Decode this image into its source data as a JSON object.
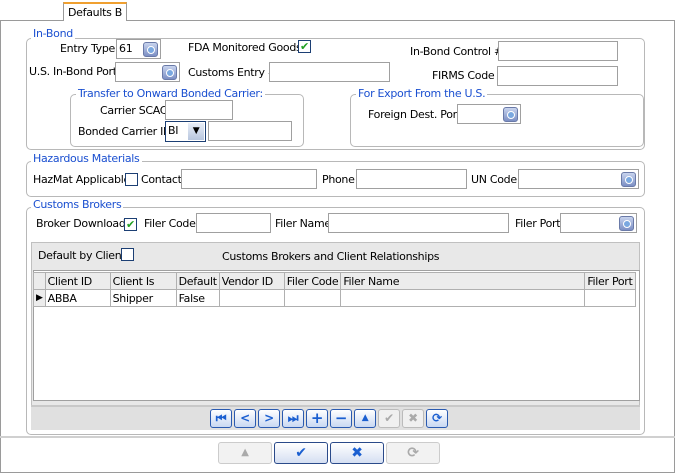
{
  "tab": {
    "label": "Defaults B"
  },
  "inbond": {
    "legend": "In-Bond",
    "entry_type_label": "Entry Type",
    "entry_type_value": "61",
    "fda_label": "FDA Monitored Goods",
    "fda_checked": true,
    "control_label": "In-Bond Control #",
    "control_value": "",
    "port_label": "U.S. In-Bond Port",
    "port_value": "",
    "customs_entry_label": "Customs Entry #",
    "customs_entry_value": "",
    "firms_label": "FIRMS Code",
    "firms_value": "",
    "transfer": {
      "legend": "Transfer to Onward Bonded Carrier:",
      "scac_label": "Carrier SCAC",
      "scac_value": "",
      "carrier_id_label": "Bonded Carrier ID",
      "carrier_id_value": "BI",
      "carrier_id_extra": ""
    },
    "export": {
      "legend": "For Export From the U.S.",
      "foreign_port_label": "Foreign Dest. Port",
      "foreign_port_value": ""
    }
  },
  "hazmat": {
    "legend": "Hazardous Materials",
    "applicable_label": "HazMat Applicable",
    "applicable_checked": false,
    "contact_label": "Contact",
    "contact_value": "",
    "phone_label": "Phone",
    "phone_value": "",
    "un_label": "UN Code",
    "un_value": ""
  },
  "brokers": {
    "legend": "Customs Brokers",
    "download_label": "Broker Download",
    "download_checked": true,
    "filer_code_label": "Filer Code",
    "filer_code_value": "",
    "filer_name_label": "Filer Name",
    "filer_name_value": "",
    "filer_port_label": "Filer Port",
    "filer_port_value": "",
    "grid": {
      "default_by_client_label": "Default by Client",
      "default_by_client_checked": false,
      "title": "Customs Brokers and Client Relationships",
      "columns": [
        "Client ID",
        "Client Is",
        "Default",
        "Vendor ID",
        "Filer Code",
        "Filer Name",
        "Filer Port"
      ],
      "rows": [
        [
          "ABBA",
          "Shipper",
          "False",
          "",
          "",
          "",
          ""
        ]
      ]
    },
    "navigator": [
      "first",
      "prior",
      "next",
      "last",
      "insert",
      "delete",
      "edit",
      "post",
      "cancel",
      "refresh"
    ]
  },
  "footer": {
    "buttons": [
      "edit",
      "post",
      "cancel",
      "refresh"
    ]
  }
}
